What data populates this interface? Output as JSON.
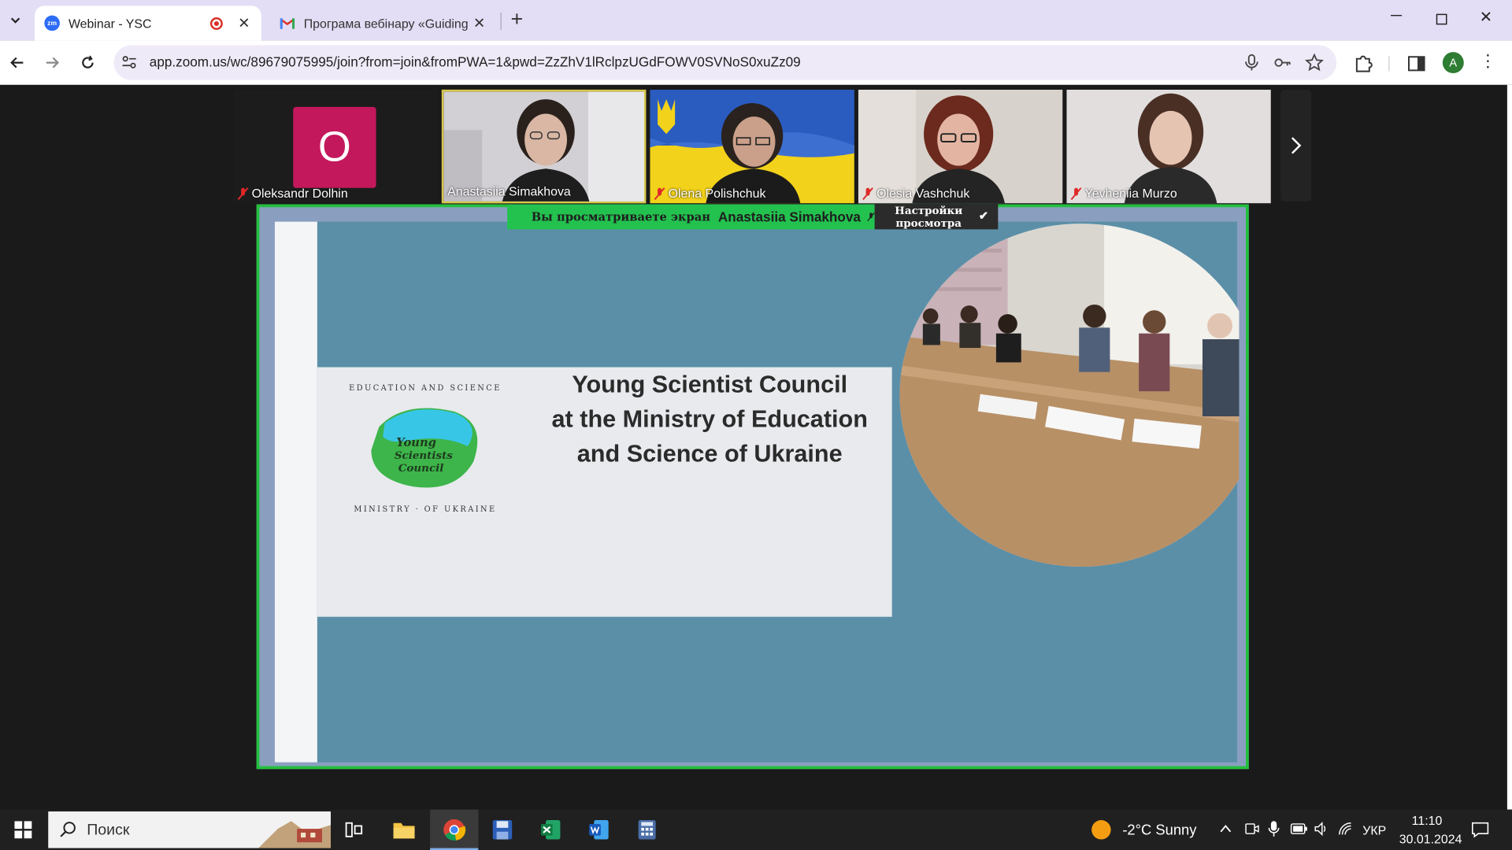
{
  "browser": {
    "tabs": [
      {
        "title": "Webinar - YSC",
        "favicon": "zoom-icon",
        "active": true,
        "recording": true
      },
      {
        "title": "Програма вебінару «Guiding U",
        "favicon": "gmail-icon",
        "active": false
      }
    ],
    "url": "app.zoom.us/wc/89679075995/join?from=join&fromPWA=1&pwd=ZzZhV1lRclpzUGdFOWV0SVNoS0xuZz09",
    "profile_initial": "A",
    "zoom_favicon_text": "zm"
  },
  "participants": [
    {
      "name": "Oleksandr Dolhin",
      "initial": "O",
      "muted": true,
      "video": false,
      "avatar_color": "#c4185c"
    },
    {
      "name": "Anastasiia Simakhova",
      "muted": false,
      "video": true,
      "speaking": true
    },
    {
      "name": "Olena Polishchuk",
      "muted": true,
      "video": true
    },
    {
      "name": "Olesia Vashchuk",
      "muted": true,
      "video": true
    },
    {
      "name": "Yevheniia Murzo",
      "muted": true,
      "video": true
    }
  ],
  "share": {
    "banner_prefix": "Вы просматриваете экран",
    "presenter": "Anastasiia Simakhova",
    "settings_label": "Настройки просмотра",
    "settings_line1": "Настройки",
    "settings_line2": "просмотра"
  },
  "slide": {
    "title_lines": [
      "Young Scientist Council",
      "at the Ministry of Education",
      "and Science of Ukraine"
    ],
    "logo_text": [
      "Young",
      "Scientists",
      "Council"
    ],
    "logo_ring_text": "EDUCATION AND SCIENCE OF UKRAINE · MINISTRY OF",
    "background_color": "#5b8fa8"
  },
  "taskbar": {
    "search_placeholder": "Поиск",
    "weather": "-2°C  Sunny",
    "language": "УКР",
    "time": "11:10",
    "date": "30.01.2024"
  },
  "colors": {
    "share_border": "#22c03c",
    "banner": "#23c24f",
    "tabbar": "#e3ddf5"
  }
}
